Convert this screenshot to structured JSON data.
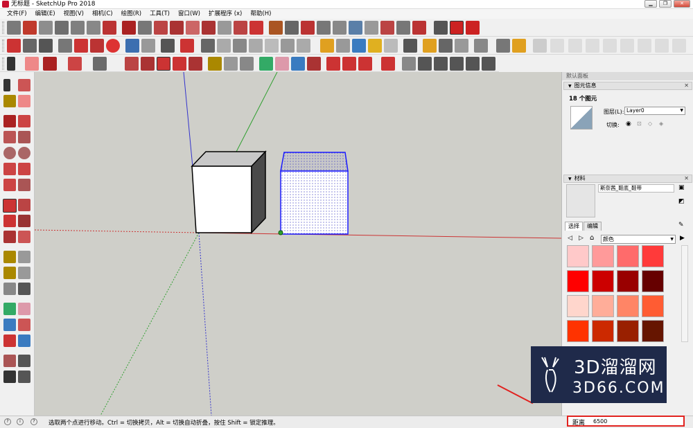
{
  "window": {
    "title": "无标题 - SketchUp Pro 2018"
  },
  "menu": [
    "文件(F)",
    "编辑(E)",
    "视图(V)",
    "相机(C)",
    "绘图(R)",
    "工具(T)",
    "窗口(W)",
    "扩展程序 (x)",
    "帮助(H)"
  ],
  "tray": {
    "title": "默认面板",
    "entity_info": {
      "header": "图元信息",
      "count": "18 个图元",
      "layer_label": "图层(L):",
      "layer_value": "Layer0",
      "toggle_label": "切换:"
    },
    "materials": {
      "header": "材料",
      "name": "斯奈茜_鞋底_鞋带",
      "tab_select": "选择",
      "tab_edit": "编辑",
      "collection": "颜色",
      "swatches": [
        "#ffc9c9",
        "#ff9a9a",
        "#ff6b6b",
        "#ff3a3a",
        "#ff0000",
        "#cc0000",
        "#990000",
        "#660000",
        "#ffd6cc",
        "#ffad99",
        "#ff8566",
        "#ff5c33",
        "#ff3300",
        "#cc2900",
        "#992000",
        "#661500"
      ]
    }
  },
  "status": {
    "text": "选取两个点进行移动。Ctrl = 切换拷贝，Alt = 切换自动折叠，按住 Shift = 锁定推理。",
    "measure_label": "距离",
    "measure_value": "6500"
  },
  "watermark": {
    "text": "3D溜溜网",
    "sub": "3D66.COM"
  },
  "colors": {
    "accent": "#e1221f",
    "selection": "#1a1aff",
    "viewport": "#cfcfc9"
  }
}
